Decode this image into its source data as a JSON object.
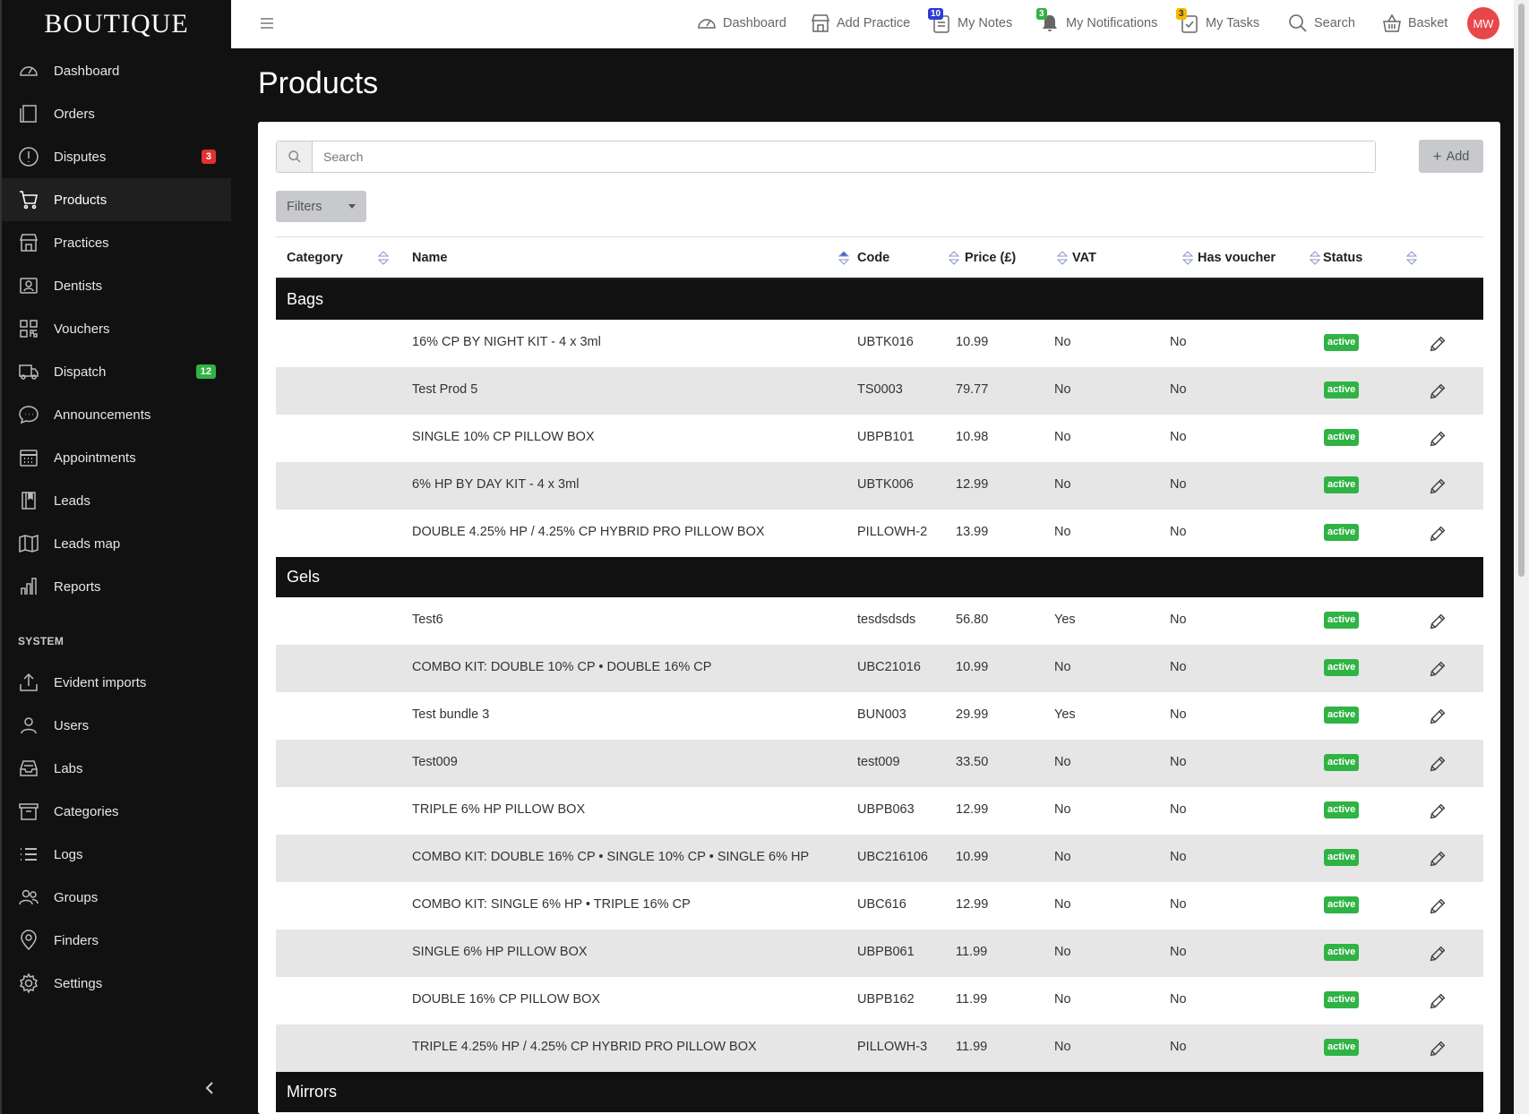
{
  "brand": "BOUTIQUE",
  "sidebar": {
    "items": [
      {
        "label": "Dashboard",
        "icon": "dashboard-icon"
      },
      {
        "label": "Orders",
        "icon": "orders-icon"
      },
      {
        "label": "Disputes",
        "icon": "alert-circle-icon",
        "badge": "3"
      },
      {
        "label": "Products",
        "icon": "cart-icon",
        "active": true
      },
      {
        "label": "Practices",
        "icon": "building-icon"
      },
      {
        "label": "Dentists",
        "icon": "id-card-icon"
      },
      {
        "label": "Vouchers",
        "icon": "qr-code-icon"
      },
      {
        "label": "Dispatch",
        "icon": "truck-icon",
        "badge": "12"
      },
      {
        "label": "Announcements",
        "icon": "chat-icon"
      },
      {
        "label": "Appointments",
        "icon": "calendar-icon"
      },
      {
        "label": "Leads",
        "icon": "notebook-icon"
      },
      {
        "label": "Leads map",
        "icon": "map-icon"
      },
      {
        "label": "Reports",
        "icon": "bar-chart-icon"
      }
    ],
    "system_label": "SYSTEM",
    "system_items": [
      {
        "label": "Evident imports",
        "icon": "upload-icon"
      },
      {
        "label": "Users",
        "icon": "user-icon"
      },
      {
        "label": "Labs",
        "icon": "inbox-icon"
      },
      {
        "label": "Categories",
        "icon": "archive-icon"
      },
      {
        "label": "Logs",
        "icon": "list-icon"
      },
      {
        "label": "Groups",
        "icon": "users-icon"
      },
      {
        "label": "Finders",
        "icon": "map-pin-icon"
      },
      {
        "label": "Settings",
        "icon": "gear-icon"
      }
    ]
  },
  "topbar": {
    "dashboard": "Dashboard",
    "add_practice": "Add Practice",
    "my_notes": "My Notes",
    "notes_count": "10",
    "my_notifications": "My Notifications",
    "notifications_count": "3",
    "my_tasks": "My Tasks",
    "tasks_count": "3",
    "search": "Search",
    "basket": "Basket",
    "avatar_initials": "MW"
  },
  "page": {
    "title": "Products",
    "search_placeholder": "Search",
    "add_label": "Add",
    "filters_label": "Filters"
  },
  "table": {
    "columns": [
      "Category",
      "Name",
      "Code",
      "Price (£)",
      "VAT",
      "Has voucher",
      "Status"
    ],
    "groups": [
      {
        "name": "Bags",
        "rows": [
          {
            "name": "16% CP BY NIGHT KIT - 4 x 3ml",
            "code": "UBTK016",
            "price": "10.99",
            "vat": "No",
            "voucher": "No",
            "status": "active"
          },
          {
            "name": "Test Prod 5",
            "code": "TS0003",
            "price": "79.77",
            "vat": "No",
            "voucher": "No",
            "status": "active"
          },
          {
            "name": "SINGLE 10% CP PILLOW BOX",
            "code": "UBPB101",
            "price": "10.98",
            "vat": "No",
            "voucher": "No",
            "status": "active"
          },
          {
            "name": "6% HP BY DAY KIT - 4 x 3ml",
            "code": "UBTK006",
            "price": "12.99",
            "vat": "No",
            "voucher": "No",
            "status": "active"
          },
          {
            "name": "DOUBLE 4.25% HP / 4.25% CP HYBRID PRO PILLOW BOX",
            "code": "PILLOWH-2",
            "price": "13.99",
            "vat": "No",
            "voucher": "No",
            "status": "active"
          }
        ]
      },
      {
        "name": "Gels",
        "rows": [
          {
            "name": "Test6",
            "code": "tesdsdsds",
            "price": "56.80",
            "vat": "Yes",
            "voucher": "No",
            "status": "active"
          },
          {
            "name": "COMBO KIT: DOUBLE 10% CP • DOUBLE 16% CP",
            "code": "UBC21016",
            "price": "10.99",
            "vat": "No",
            "voucher": "No",
            "status": "active"
          },
          {
            "name": "Test bundle 3",
            "code": "BUN003",
            "price": "29.99",
            "vat": "Yes",
            "voucher": "No",
            "status": "active"
          },
          {
            "name": "Test009",
            "code": "test009",
            "price": "33.50",
            "vat": "No",
            "voucher": "No",
            "status": "active"
          },
          {
            "name": "TRIPLE 6% HP PILLOW BOX",
            "code": "UBPB063",
            "price": "12.99",
            "vat": "No",
            "voucher": "No",
            "status": "active"
          },
          {
            "name": "COMBO KIT: DOUBLE 16% CP • SINGLE 10% CP • SINGLE 6% HP",
            "code": "UBC216106",
            "price": "10.99",
            "vat": "No",
            "voucher": "No",
            "status": "active"
          },
          {
            "name": "COMBO KIT: SINGLE 6% HP • TRIPLE 16% CP",
            "code": "UBC616",
            "price": "12.99",
            "vat": "No",
            "voucher": "No",
            "status": "active"
          },
          {
            "name": "SINGLE 6% HP PILLOW BOX",
            "code": "UBPB061",
            "price": "11.99",
            "vat": "No",
            "voucher": "No",
            "status": "active"
          },
          {
            "name": "DOUBLE 16% CP PILLOW BOX",
            "code": "UBPB162",
            "price": "11.99",
            "vat": "No",
            "voucher": "No",
            "status": "active"
          },
          {
            "name": "TRIPLE 4.25% HP / 4.25% CP HYBRID PRO PILLOW BOX",
            "code": "PILLOWH-3",
            "price": "11.99",
            "vat": "No",
            "voucher": "No",
            "status": "active"
          }
        ]
      },
      {
        "name": "Mirrors",
        "rows": []
      }
    ]
  },
  "colors": {
    "sidebar_bg": "#111111",
    "status_active": "#2fb344",
    "badge_red": "#e03131",
    "avatar": "#e8474a",
    "row_alt": "#e6e6e6"
  }
}
